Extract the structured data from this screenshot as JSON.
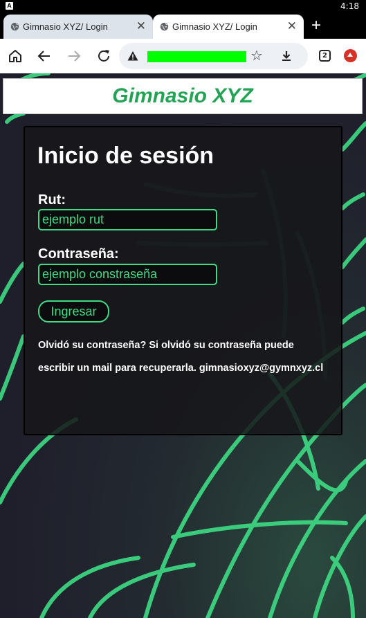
{
  "status_bar": {
    "time": "4:18",
    "app_badge": "A"
  },
  "tabs": [
    {
      "title": "Gimnasio XYZ/ Login",
      "active": false
    },
    {
      "title": "Gimnasio XYZ/ Login",
      "active": true
    }
  ],
  "toolbar": {
    "tab_count": "2",
    "url": ""
  },
  "page": {
    "brand": "Gimnasio XYZ",
    "heading": "Inicio de sesión",
    "rut_label": "Rut:",
    "rut_value": "ejemplo rut",
    "password_label": "Contraseña:",
    "password_value": "ejemplo constraseña",
    "submit_label": "Ingresar",
    "help_line_1": "Olvidó su contraseña? Si olvidó su contraseña puede",
    "help_line_2": "escribir un mail para recuperarla. gimnasioxyz@gymnxyz.cl"
  },
  "colors": {
    "accent": "#3ddc84",
    "brand": "#23a455",
    "url_highlight": "#00ff00"
  }
}
